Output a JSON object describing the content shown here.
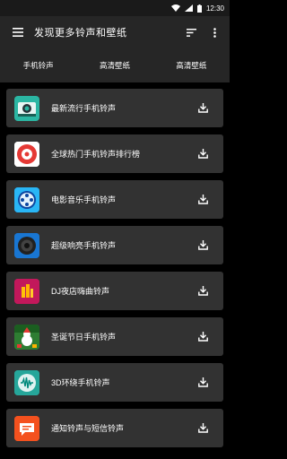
{
  "status": {
    "time": "12:30"
  },
  "header": {
    "title": "发现更多铃声和壁纸"
  },
  "tabs": [
    "手机铃声",
    "高清壁纸",
    "高清壁纸"
  ],
  "items": [
    {
      "label": "最新流行手机铃声",
      "icon": "camera-app-icon",
      "color": "#2bb6a3"
    },
    {
      "label": "全球热门手机铃声排行榜",
      "icon": "music-record-icon",
      "color": "#e53935"
    },
    {
      "label": "电影音乐手机铃声",
      "icon": "film-reel-icon",
      "color": "#1e88e5"
    },
    {
      "label": "超级响亮手机铃声",
      "icon": "speaker-icon",
      "color": "#1565c0"
    },
    {
      "label": "DJ夜店嗨曲铃声",
      "icon": "dj-party-icon",
      "color": "#d81b60"
    },
    {
      "label": "圣诞节日手机铃声",
      "icon": "christmas-icon",
      "color": "#2e7d32"
    },
    {
      "label": "3D环绕手机铃声",
      "icon": "soundwave-icon",
      "color": "#26a69a"
    },
    {
      "label": "通知铃声与短信铃声",
      "icon": "message-bubble-icon",
      "color": "#f4511e"
    }
  ]
}
